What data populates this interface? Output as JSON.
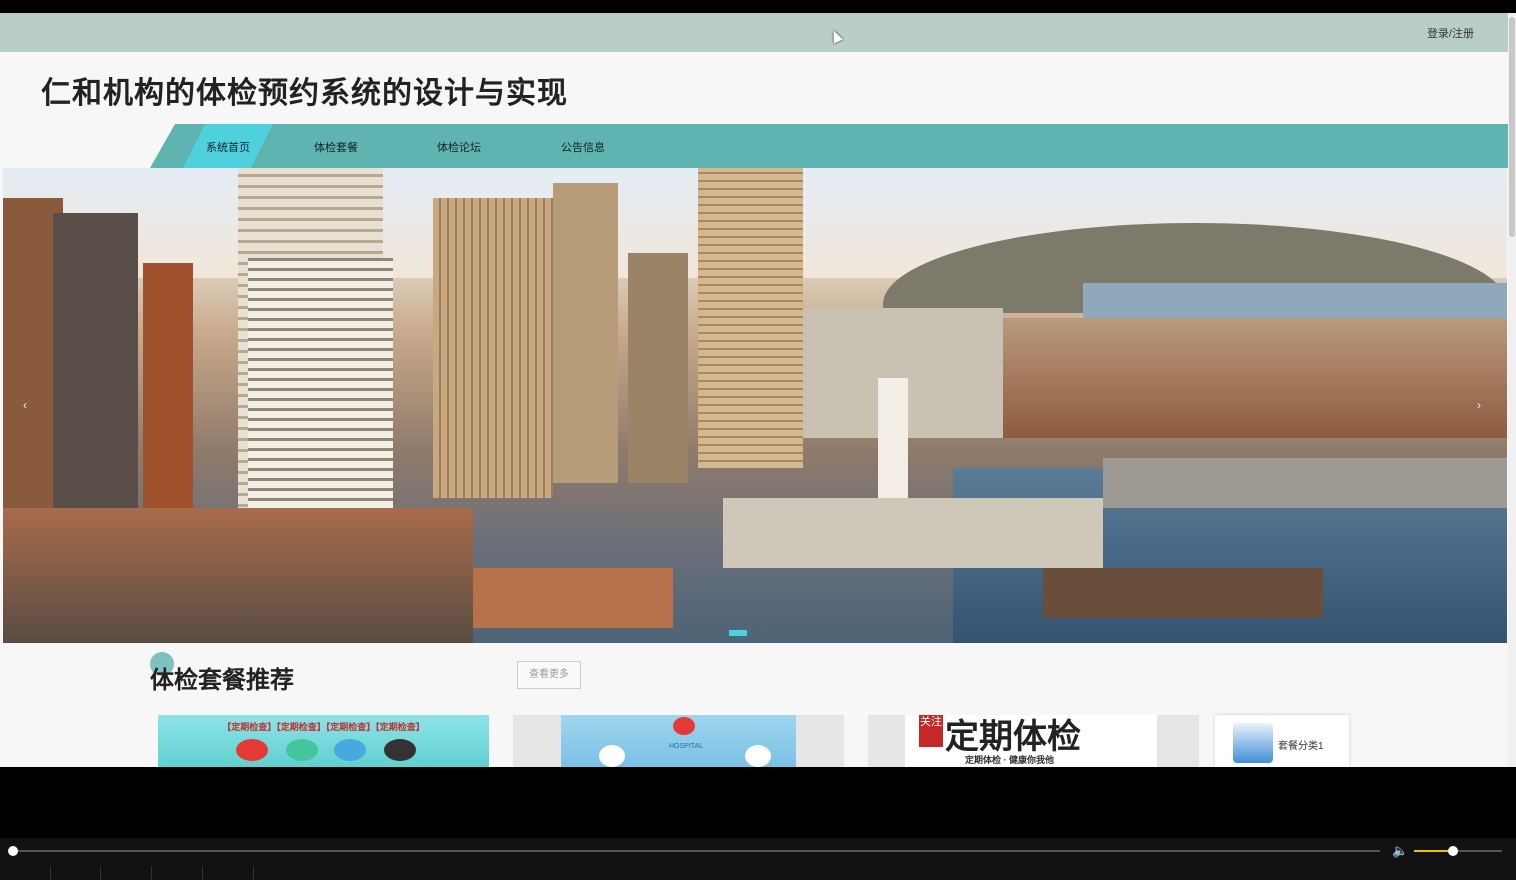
{
  "header": {
    "login_label": "登录/注册"
  },
  "site": {
    "title": "仁和机构的体检预约系统的设计与实现"
  },
  "nav": {
    "items": [
      "系统首页",
      "体检套餐",
      "体检论坛",
      "公告信息"
    ]
  },
  "banner": {
    "prev": "‹",
    "next": "›"
  },
  "recommend": {
    "title": "体检套餐推荐",
    "more_label": "查看更多",
    "card1_strip": "【定期检查】【定期检查】【定期检查】【定期检查】",
    "card2_text": "HOSPITAL",
    "card3_red": "关注",
    "card3_big": "定期体检",
    "card3_sub": "定期体检 · 健康你我他",
    "card4_label": "套餐分类1"
  },
  "player": {
    "volume_icon": "🔈",
    "progress_fraction": 0.0,
    "volume_fraction": 0.45
  },
  "colors": {
    "topbar": "#b9cfc6",
    "nav": "#5fb3b0",
    "nav_active": "#4fd1dd"
  }
}
